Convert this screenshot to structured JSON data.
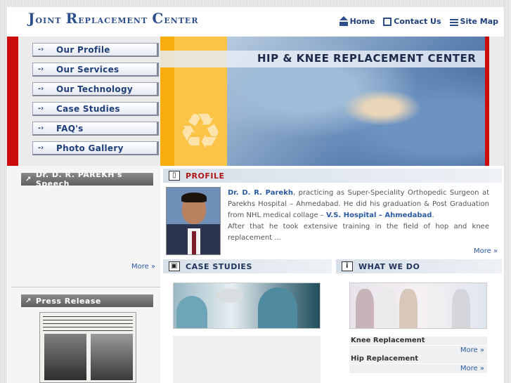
{
  "header": {
    "logo_part1": "J",
    "logo_part2": "oint ",
    "logo_part3": "R",
    "logo_part4": "eplacement ",
    "logo_part5": "C",
    "logo_part6": "enter",
    "nav": [
      {
        "label": "Home",
        "icon": "home-icon"
      },
      {
        "label": "Contact Us",
        "icon": "mail-icon"
      },
      {
        "label": "Site Map",
        "icon": "sitemap-icon"
      }
    ]
  },
  "menu": {
    "items": [
      {
        "label": "Our Profile"
      },
      {
        "label": "Our Services"
      },
      {
        "label": "Our Technology"
      },
      {
        "label": "Case Studies"
      },
      {
        "label": "FAQ's"
      },
      {
        "label": "Photo Gallery"
      }
    ]
  },
  "hero": {
    "title": "HIP & KNEE REPLACEMENT CENTER"
  },
  "left": {
    "speech_title": "Dr. D. R. PAREKH's Speech",
    "speech_more": "More",
    "press_title": "Press Release"
  },
  "profile": {
    "heading": "PROFILE",
    "name": "Dr. D. R. Parekh",
    "text1": ", practicing as Super-Speciality Orthopedic Surgeon at Parekhs Hospital – Ahmedabad. He did his graduation & Post Graduation from NHL medical collage – ",
    "hospital": "V.S. Hospital – Ahmedabad",
    "text2": ".",
    "text3": "After that he took extensive training in the field of hop and knee replacement ...",
    "more": "More"
  },
  "case_studies": {
    "heading": "CASE STUDIES"
  },
  "what_we_do": {
    "heading": "WHAT WE DO",
    "items": [
      {
        "label": "Knee Replacement",
        "more": "More"
      },
      {
        "label": "Hip Replacement",
        "more": "More"
      }
    ]
  },
  "colors": {
    "brand_blue": "#1f3f7a",
    "accent_red": "#cc0c0c",
    "banner_orange": "#f7ad0c"
  }
}
